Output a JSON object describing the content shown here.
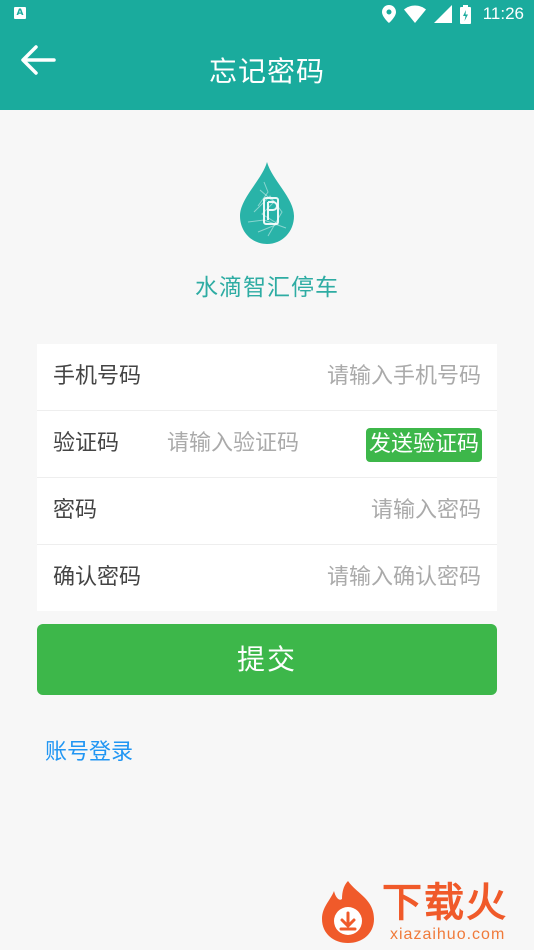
{
  "status_bar": {
    "app_badge": "A",
    "time": "11:26"
  },
  "toolbar": {
    "title": "忘记密码"
  },
  "brand": {
    "app_name": "水滴智汇停车"
  },
  "form": {
    "phone": {
      "label": "手机号码",
      "placeholder": "请输入手机号码"
    },
    "code": {
      "label": "验证码",
      "placeholder": "请输入验证码",
      "send_button": "发送验证码"
    },
    "password": {
      "label": "密码",
      "placeholder": "请输入密码"
    },
    "confirm": {
      "label": "确认密码",
      "placeholder": "请输入确认密码"
    }
  },
  "submit_label": "提交",
  "account_login_label": "账号登录",
  "watermark": {
    "text": "下载火",
    "url": "xiazaihuo.com"
  },
  "colors": {
    "primary_teal": "#1aab9d",
    "button_green": "#3db74a",
    "link_blue": "#2196f3",
    "watermark_orange": "#f05a2a"
  }
}
